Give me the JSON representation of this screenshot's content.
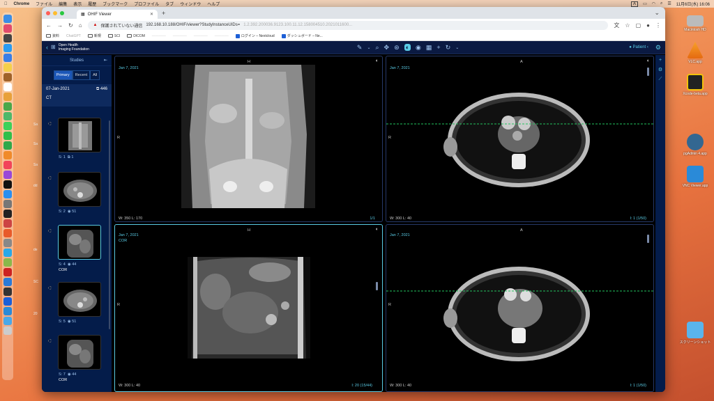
{
  "menubar": {
    "app": "Chrome",
    "items": [
      "ファイル",
      "編集",
      "表示",
      "履歴",
      "ブックマーク",
      "プロファイル",
      "タブ",
      "ウィンドウ",
      "ヘルプ"
    ],
    "input": "A",
    "datetime": "11月6日(水) 16:06"
  },
  "desktop": {
    "right_items": [
      "Macintosh HD",
      "VLC.app",
      "Xcode-beta.app",
      "pgAdmin 4.app",
      "VNC Viewer.app",
      "スクリーンショット"
    ],
    "left_items": [
      "Sa",
      "Sa",
      "Sa",
      "dd",
      "de",
      "SC",
      "20"
    ]
  },
  "browser": {
    "tab_title": "OHIF Viewer",
    "security": "保護されていない通信",
    "url": "192.168.10.188/OHIF/viewer?StudyInstanceUIDs=",
    "url_blurred": "1.2.392.200036.9123.100.11.12.158004510.2021011600...",
    "bookmarks": [
      "資料",
      "ChatGPT",
      "新規",
      "SCI",
      "DICOM",
      "————",
      "————",
      "————",
      "————",
      "ログイン – Nextcloud",
      "ダッシュボード – Ne..."
    ]
  },
  "ohif": {
    "logo_line1": "Open Health",
    "logo_line2": "Imaging Foundation",
    "patient_label": "Patient",
    "panel": {
      "title": "Studies",
      "segments": [
        "Primary",
        "Recent",
        "All"
      ],
      "date": "07-Jan-2021",
      "count": "446",
      "modality": "CT",
      "thumbs": [
        {
          "series": "S: 1",
          "frames": "1",
          "label": ""
        },
        {
          "series": "S: 2",
          "frames": "51",
          "label": ""
        },
        {
          "series": "S: 4",
          "frames": "44",
          "label": "COR"
        },
        {
          "series": "S: 5",
          "frames": "51",
          "label": ""
        },
        {
          "series": "S: 7",
          "frames": "44",
          "label": "COR"
        }
      ]
    },
    "viewports": [
      {
        "date": "Jan 7, 2021",
        "sub": "",
        "top": "H",
        "left": "R",
        "wl": "W: 350  L: 170",
        "idx": "1/1"
      },
      {
        "date": "Jan 7, 2021",
        "sub": "",
        "top": "A",
        "left": "R",
        "wl": "W: 300  L: 40",
        "idx": "I: 1 (1/50)"
      },
      {
        "date": "Jan 7, 2021",
        "sub": "COR",
        "top": "H",
        "left": "R",
        "wl": "W: 300  L: 40",
        "idx": "I: 20 (15/44)"
      },
      {
        "date": "Jan 7, 2021",
        "sub": "",
        "top": "A",
        "left": "R",
        "wl": "W: 300  L: 40",
        "idx": "I: 1 (1/50)"
      }
    ]
  }
}
